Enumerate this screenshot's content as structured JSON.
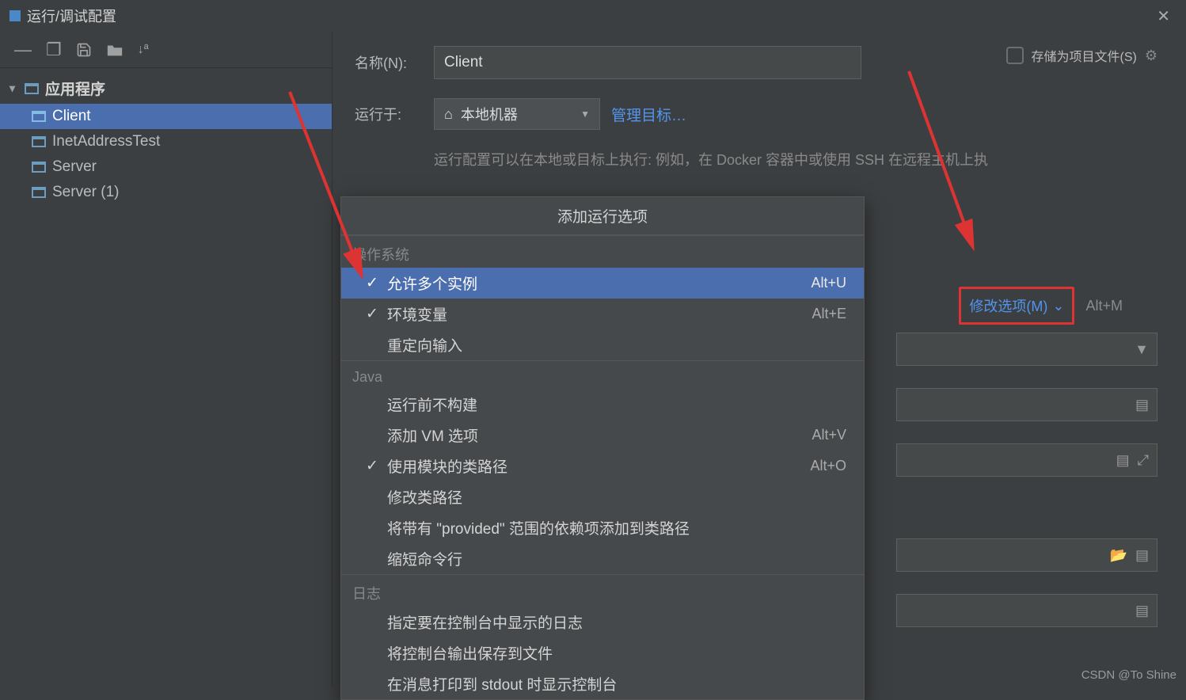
{
  "window": {
    "title": "运行/调试配置"
  },
  "sidebar": {
    "section": "应用程序",
    "items": [
      {
        "label": "Client"
      },
      {
        "label": "InetAddressTest"
      },
      {
        "label": "Server"
      },
      {
        "label": "Server (1)"
      }
    ]
  },
  "form": {
    "name_label": "名称(N):",
    "name_value": "Client",
    "run_on_label": "运行于:",
    "run_on_value": "本地机器",
    "manage_targets": "管理目标…",
    "hint": "运行配置可以在本地或目标上执行: 例如，在 Docker 容器中或使用 SSH 在远程主机上执",
    "store_as_project": "存储为项目文件(S)",
    "modify_options": "修改选项(M)",
    "modify_shortcut": "Alt+M"
  },
  "popup": {
    "title": "添加运行选项",
    "sections": [
      {
        "header": "操作系统",
        "items": [
          {
            "label": "允许多个实例",
            "shortcut": "Alt+U",
            "checked": true,
            "highlighted": true
          },
          {
            "label": "环境变量",
            "shortcut": "Alt+E",
            "checked": true
          },
          {
            "label": "重定向输入",
            "shortcut": "",
            "checked": false
          }
        ]
      },
      {
        "header": "Java",
        "items": [
          {
            "label": "运行前不构建",
            "shortcut": "",
            "checked": false
          },
          {
            "label": "添加 VM 选项",
            "shortcut": "Alt+V",
            "checked": false
          },
          {
            "label": "使用模块的类路径",
            "shortcut": "Alt+O",
            "checked": true
          },
          {
            "label": "修改类路径",
            "shortcut": "",
            "checked": false
          },
          {
            "label": "将带有 \"provided\" 范围的依赖项添加到类路径",
            "shortcut": "",
            "checked": false
          },
          {
            "label": "缩短命令行",
            "shortcut": "",
            "checked": false
          }
        ]
      },
      {
        "header": "日志",
        "items": [
          {
            "label": "指定要在控制台中显示的日志",
            "shortcut": "",
            "checked": false
          },
          {
            "label": "将控制台输出保存到文件",
            "shortcut": "",
            "checked": false
          },
          {
            "label": "在消息打印到 stdout 时显示控制台",
            "shortcut": "",
            "checked": false
          }
        ]
      }
    ]
  },
  "watermark": "CSDN @To Shine"
}
